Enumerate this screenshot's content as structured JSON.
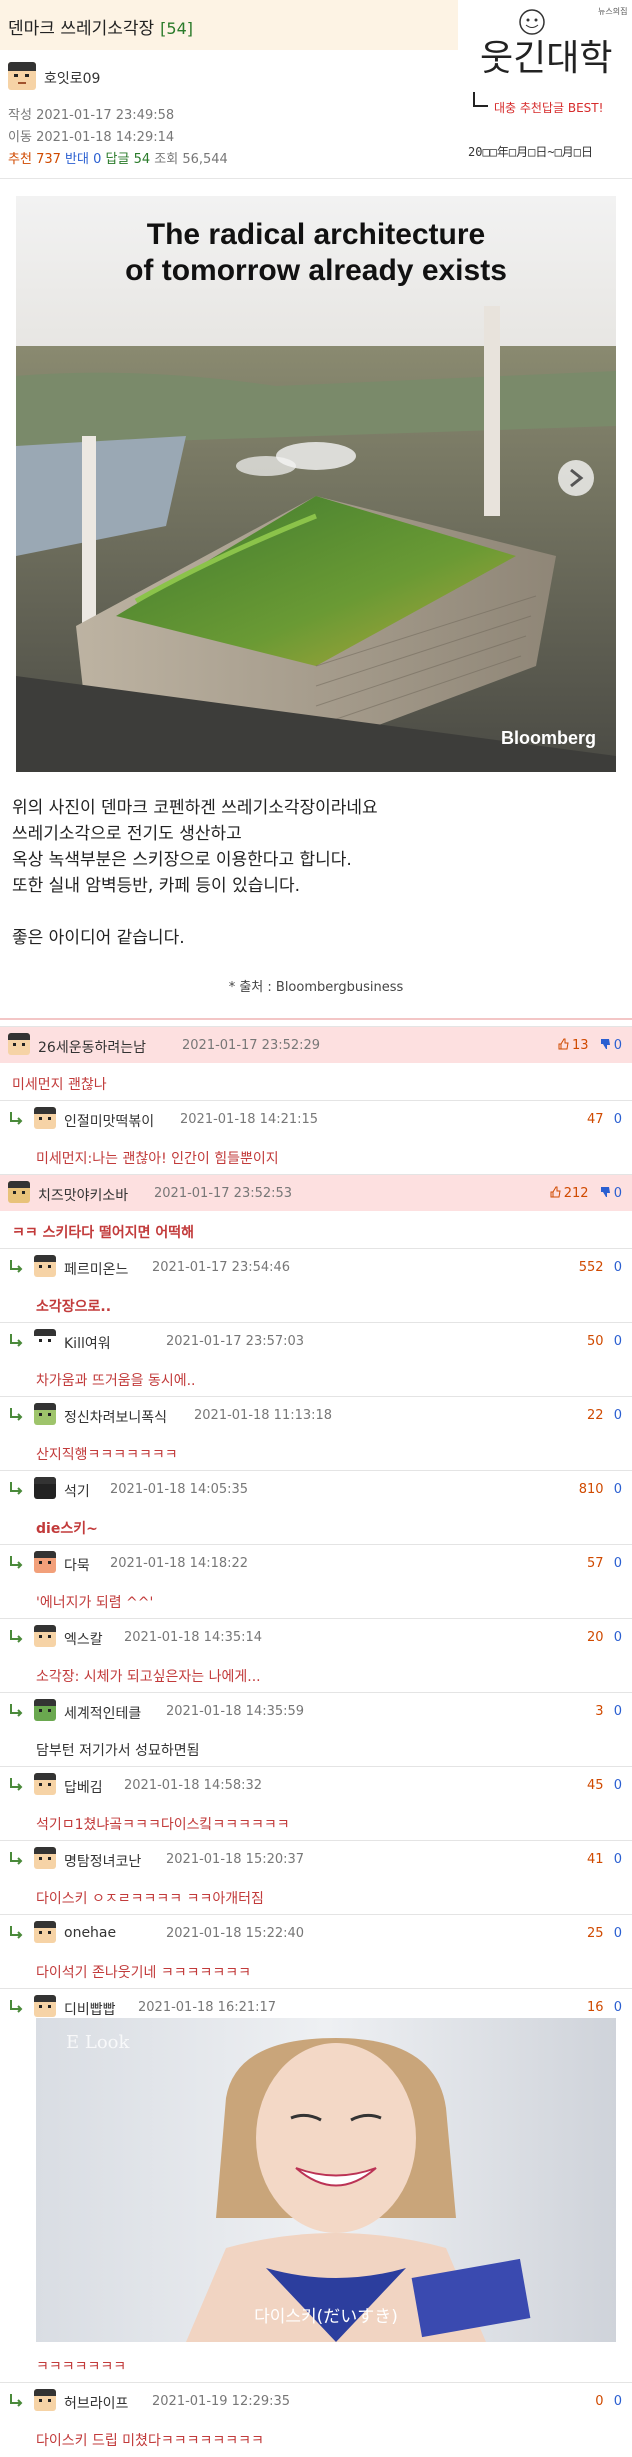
{
  "post": {
    "title": "덴마크 쓰레기소각장",
    "comment_count": "[54]",
    "author": "호잇로09",
    "created_label": "작성",
    "created": "2021-01-17 23:49:58",
    "moved_label": "이동",
    "moved": "2021-01-18 14:29:14",
    "rec_label": "추천",
    "rec": "737",
    "opp_label": "반대",
    "opp": "0",
    "rep_label": "답글",
    "rep": "54",
    "views_label": "조회",
    "views": "56,544"
  },
  "logo": {
    "brand": "웃긴대학",
    "tagline": "대충 추천답글 BEST!",
    "date_line": "20□□年□月□日~□月□日",
    "corner": "뉴스의집"
  },
  "photo": {
    "headline_1": "The radical architecture",
    "headline_2": "of tomorrow already exists",
    "credit": "Bloomberg"
  },
  "body": {
    "lines": [
      "위의 사진이 덴마크 코펜하겐 쓰레기소각장이라네요",
      "쓰레기소각으로 전기도 생산하고",
      "옥상 녹색부분은 스키장으로 이용한다고 합니다.",
      "또한 실내 암벽등반, 카페 등이 있습니다.",
      "좋은 아이디어 같습니다."
    ],
    "source": "* 출처 : Bloombergbusiness"
  },
  "comments": [
    {
      "nick": "26세운동하려는남",
      "time": "2021-01-17 23:52:29",
      "up": "13",
      "down": "0",
      "text": "미세먼지 괜찮나",
      "reply": false,
      "hl": true,
      "bold": false,
      "dark": false
    },
    {
      "nick": "인절미맛떡볶이",
      "time": "2021-01-18 14:21:15",
      "up": "47",
      "down": "0",
      "text": "미세먼지:나는 괜찮아! 인간이 힘들뿐이지",
      "reply": true,
      "hl": false,
      "bold": false,
      "dark": false
    },
    {
      "nick": "치즈맛야키소바",
      "time": "2021-01-17 23:52:53",
      "up": "212",
      "down": "0",
      "text": "ㅋㅋ 스키타다 떨어지면 어떡해",
      "reply": false,
      "hl": true,
      "bold": true,
      "dark": false
    },
    {
      "nick": "페르미온느",
      "time": "2021-01-17 23:54:46",
      "up": "552",
      "down": "0",
      "text": "소각장으로..",
      "reply": true,
      "hl": false,
      "bold": true,
      "dark": false
    },
    {
      "nick": "Kill여워",
      "time": "2021-01-17 23:57:03",
      "up": "50",
      "down": "0",
      "text": "차가움과 뜨거움을 동시에..",
      "reply": true,
      "hl": false,
      "bold": false,
      "dark": false
    },
    {
      "nick": "정신차려보니폭식",
      "time": "2021-01-18 11:13:18",
      "up": "22",
      "down": "0",
      "text": "산지직행ㅋㅋㅋㅋㅋㅋㅋ",
      "reply": true,
      "hl": false,
      "bold": false,
      "dark": false
    },
    {
      "nick": "석기",
      "time": "2021-01-18 14:05:35",
      "up": "810",
      "down": "0",
      "text": "die스키~",
      "reply": true,
      "hl": false,
      "bold": true,
      "dark": false
    },
    {
      "nick": "다묵",
      "time": "2021-01-18 14:18:22",
      "up": "57",
      "down": "0",
      "text": "'에너지가 되렴 ^^'",
      "reply": true,
      "hl": false,
      "bold": false,
      "dark": false
    },
    {
      "nick": "엑스칼",
      "time": "2021-01-18 14:35:14",
      "up": "20",
      "down": "0",
      "text": "소각장: 시체가 되고싶은자는 나에게...",
      "reply": true,
      "hl": false,
      "bold": false,
      "dark": false
    },
    {
      "nick": "세계적인테클",
      "time": "2021-01-18 14:35:59",
      "up": "3",
      "down": "0",
      "text": "담부턴 저기가서 성묘하면됨",
      "reply": true,
      "hl": false,
      "bold": false,
      "dark": true
    },
    {
      "nick": "답베김",
      "time": "2021-01-18 14:58:32",
      "up": "45",
      "down": "0",
      "text": "석기ㅁ1쳤냐곸ㅋㅋㅋ다이스킼ㅋㅋㅋㅋㅋㅋ",
      "reply": true,
      "hl": false,
      "bold": false,
      "dark": false
    },
    {
      "nick": "명탐정녀코난",
      "time": "2021-01-18 15:20:37",
      "up": "41",
      "down": "0",
      "text": "다이스키 ㅇㅈㄹㅋㅋㅋㅋ ㅋㅋ아개터짐",
      "reply": true,
      "hl": false,
      "bold": false,
      "dark": false
    },
    {
      "nick": "onehae",
      "time": "2021-01-18 15:22:40",
      "up": "25",
      "down": "0",
      "text": "다이석기 존나웃기네 ㅋㅋㅋㅋㅋㅋㅋ",
      "reply": true,
      "hl": false,
      "bold": false,
      "dark": false
    },
    {
      "nick": "디비빱빱",
      "time": "2021-01-18 16:21:17",
      "up": "16",
      "down": "0",
      "text": "ㅋㅋㅋㅋㅋㅋㅋ",
      "reply": true,
      "hl": false,
      "bold": false,
      "dark": false
    },
    {
      "nick": "허브라이프",
      "time": "2021-01-19 12:29:35",
      "up": "0",
      "down": "0",
      "text": "다이스키 드립 미쳤다ㅋㅋㅋㅋㅋㅋㅋㅋ",
      "reply": true,
      "hl": false,
      "bold": false,
      "dark": false
    }
  ],
  "gif": {
    "caption": "다이스키(だいすき)",
    "watermark": "E Look"
  },
  "colors": {
    "title_bg": "#fdf3e4",
    "highlight_row": "#fde0e0",
    "upvote": "#d04a00",
    "downvote": "#2a5fd1",
    "comment_text": "#c23b3b"
  }
}
